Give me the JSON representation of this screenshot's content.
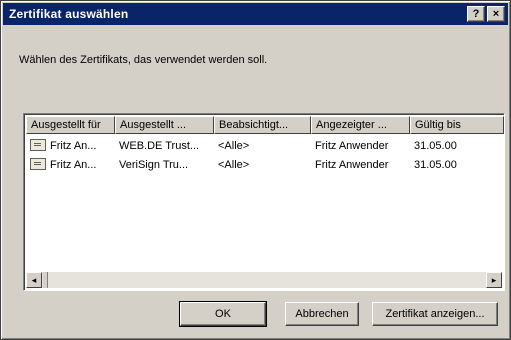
{
  "window": {
    "title": "Zertifikat auswählen",
    "help_glyph": "?",
    "close_glyph": "×"
  },
  "instruction": "Wählen des Zertifikats, das verwendet werden soll.",
  "columns": [
    "Ausgestellt für",
    "Ausgestellt ...",
    "Beabsichtigt...",
    "Angezeigter ...",
    "Gültig bis"
  ],
  "rows": [
    [
      "Fritz An...",
      "WEB.DE Trust...",
      "<Alle>",
      "Fritz Anwender",
      "31.05.00"
    ],
    [
      "Fritz An...",
      "VeriSign Tru...",
      "<Alle>",
      "Fritz Anwender",
      "31.05.00"
    ]
  ],
  "scroll": {
    "left_glyph": "◂",
    "right_glyph": "▸"
  },
  "buttons": {
    "ok": "OK",
    "cancel": "Abbrechen",
    "show_cert": "Zertifikat anzeigen..."
  }
}
